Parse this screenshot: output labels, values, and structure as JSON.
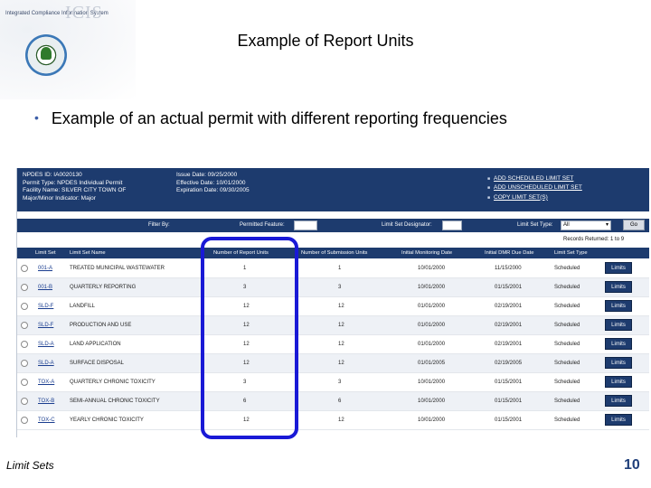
{
  "logo": {
    "system_name": "Integrated Compliance Information System",
    "acronym": "ICIS",
    "seal_icon": "epa-seal-icon"
  },
  "slide": {
    "title": "Example of Report Units",
    "bullet": "Example of an actual permit with different reporting frequencies",
    "footer_left": "Limit Sets",
    "page_number": "10"
  },
  "screenshot": {
    "info_lines": [
      "NPDES ID: IA0020130",
      "Permit Type: NPDES Individual Permit",
      "Facility Name: SILVER CITY TOWN OF",
      "Major/Minor Indicator: Major"
    ],
    "date_lines": [
      "Issue Date: 09/25/2000",
      "Effective Date: 10/01/2000",
      "Expiration Date: 09/30/2005"
    ],
    "action_links": [
      "ADD SCHEDULED LIMIT SET",
      "ADD UNSCHEDULED LIMIT SET",
      "COPY LIMIT SET(S)"
    ],
    "filter": {
      "label": "Filter By:",
      "permitted_feature_label": "Permitted Feature:",
      "designator_label": "Limit Set Designator:",
      "type_label": "Limit Set Type:",
      "type_value": "All",
      "go_label": "Go"
    },
    "report_count": "Records Returned: 1 to 9",
    "columns": [
      "Limit Set",
      "Limit Set Name",
      "Number of Report Units",
      "Number of Submission Units",
      "Initial Monitoring Date",
      "Initial DMR Due Date",
      "Limit Set Type"
    ],
    "rows": [
      {
        "limit_set": "001-A",
        "name": "TREATED MUNICIPAL WASTEWATER",
        "report_units": "1",
        "submission_units": "1",
        "monitoring_date": "10/01/2000",
        "dmr_due": "11/15/2000",
        "type": "Scheduled",
        "action": "Limits"
      },
      {
        "limit_set": "001-B",
        "name": "QUARTERLY REPORTING",
        "report_units": "3",
        "submission_units": "3",
        "monitoring_date": "10/01/2000",
        "dmr_due": "01/15/2001",
        "type": "Scheduled",
        "action": "Limits"
      },
      {
        "limit_set": "SLD-F",
        "name": "LANDFILL",
        "report_units": "12",
        "submission_units": "12",
        "monitoring_date": "01/01/2000",
        "dmr_due": "02/19/2001",
        "type": "Scheduled",
        "action": "Limits"
      },
      {
        "limit_set": "SLD-F",
        "name": "PRODUCTION AND USE",
        "report_units": "12",
        "submission_units": "12",
        "monitoring_date": "01/01/2000",
        "dmr_due": "02/19/2001",
        "type": "Scheduled",
        "action": "Limits"
      },
      {
        "limit_set": "SLD-A",
        "name": "LAND APPLICATION",
        "report_units": "12",
        "submission_units": "12",
        "monitoring_date": "01/01/2000",
        "dmr_due": "02/19/2001",
        "type": "Scheduled",
        "action": "Limits"
      },
      {
        "limit_set": "SLD-A",
        "name": "SURFACE DISPOSAL",
        "report_units": "12",
        "submission_units": "12",
        "monitoring_date": "01/01/2005",
        "dmr_due": "02/19/2005",
        "type": "Scheduled",
        "action": "Limits"
      },
      {
        "limit_set": "TOX-A",
        "name": "QUARTERLY CHRONIC TOXICITY",
        "report_units": "3",
        "submission_units": "3",
        "monitoring_date": "10/01/2000",
        "dmr_due": "01/15/2001",
        "type": "Scheduled",
        "action": "Limits"
      },
      {
        "limit_set": "TOX-B",
        "name": "SEMI-ANNUAL CHRONIC TOXICITY",
        "report_units": "6",
        "submission_units": "6",
        "monitoring_date": "10/01/2000",
        "dmr_due": "01/15/2001",
        "type": "Scheduled",
        "action": "Limits"
      },
      {
        "limit_set": "TOX-C",
        "name": "YEARLY CHRONIC TOXICITY",
        "report_units": "12",
        "submission_units": "12",
        "monitoring_date": "10/01/2000",
        "dmr_due": "01/15/2001",
        "type": "Scheduled",
        "action": "Limits"
      }
    ]
  },
  "colors": {
    "header_bg": "#1d3b6e",
    "highlight": "#1919d6",
    "row_alt": "#eef1f6",
    "page_number": "#1f3f7a"
  }
}
